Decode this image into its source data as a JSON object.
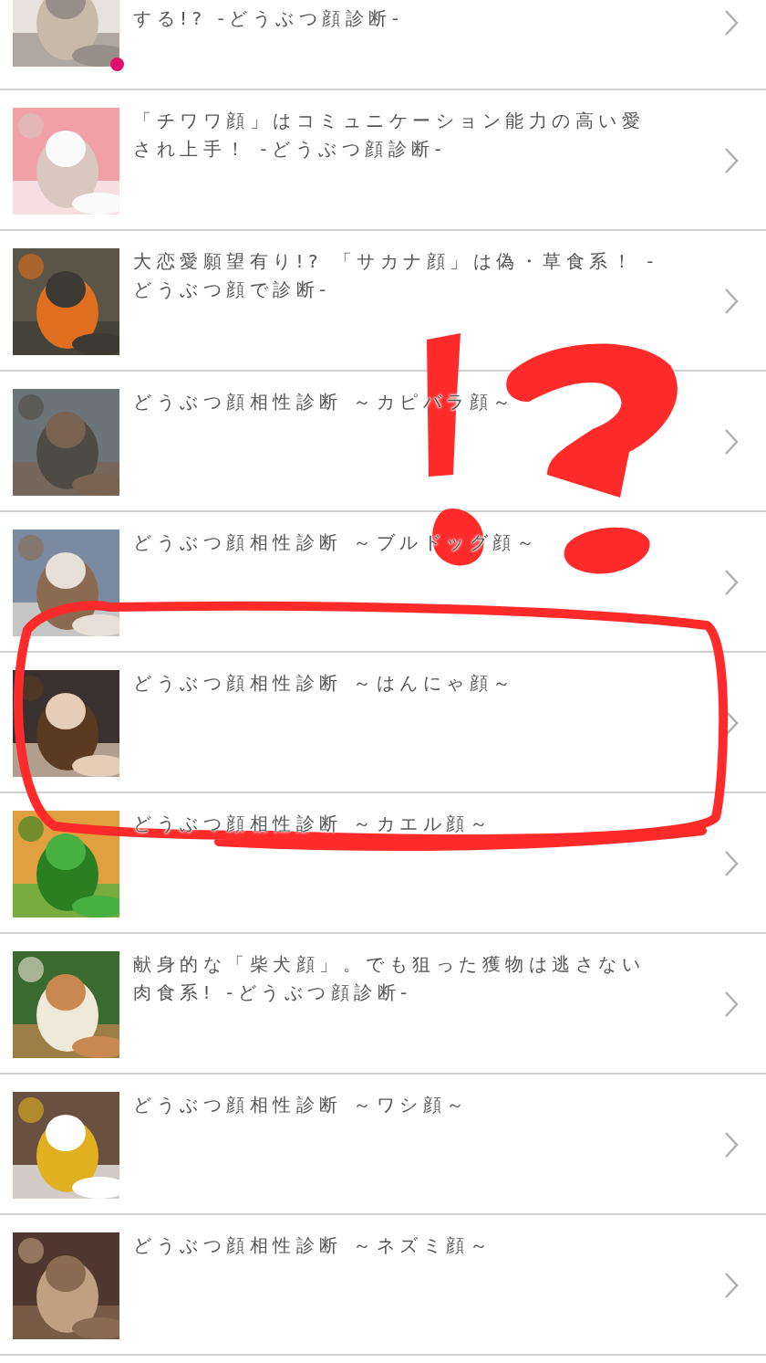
{
  "articles": [
    {
      "title": "する!? -どうぶつ顔診断-",
      "unread": true,
      "cut_top": true
    },
    {
      "title": "「チワワ顔」はコミュニケーション能力の高い愛され上手！ -どうぶつ顔診断-",
      "unread": false,
      "cut_top": false
    },
    {
      "title": "大恋愛願望有り!? 「サカナ顔」は偽・草食系！ -\nどうぶつ顔で診断-",
      "unread": false,
      "cut_top": false
    },
    {
      "title": "どうぶつ顔相性診断 ～カピバラ顔～",
      "unread": false,
      "cut_top": false
    },
    {
      "title": "どうぶつ顔相性診断 ～ブルドッグ顔～",
      "unread": false,
      "cut_top": false
    },
    {
      "title": "どうぶつ顔相性診断 ～はんにゃ顔～",
      "unread": false,
      "cut_top": false
    },
    {
      "title": "どうぶつ顔相性診断 ～カエル顔～",
      "unread": false,
      "cut_top": false
    },
    {
      "title": "献身的な「柴犬顔」。でも狙った獲物は逃さない肉食系! -どうぶつ顔診断-",
      "unread": false,
      "cut_top": false
    },
    {
      "title": "どうぶつ顔相性診断 ～ワシ顔～",
      "unread": false,
      "cut_top": false
    },
    {
      "title": "どうぶつ顔相性診断 ～ネズミ顔～",
      "unread": false,
      "cut_top": false
    }
  ],
  "annotation": {
    "kind": "exclamation-question-and-loop"
  }
}
